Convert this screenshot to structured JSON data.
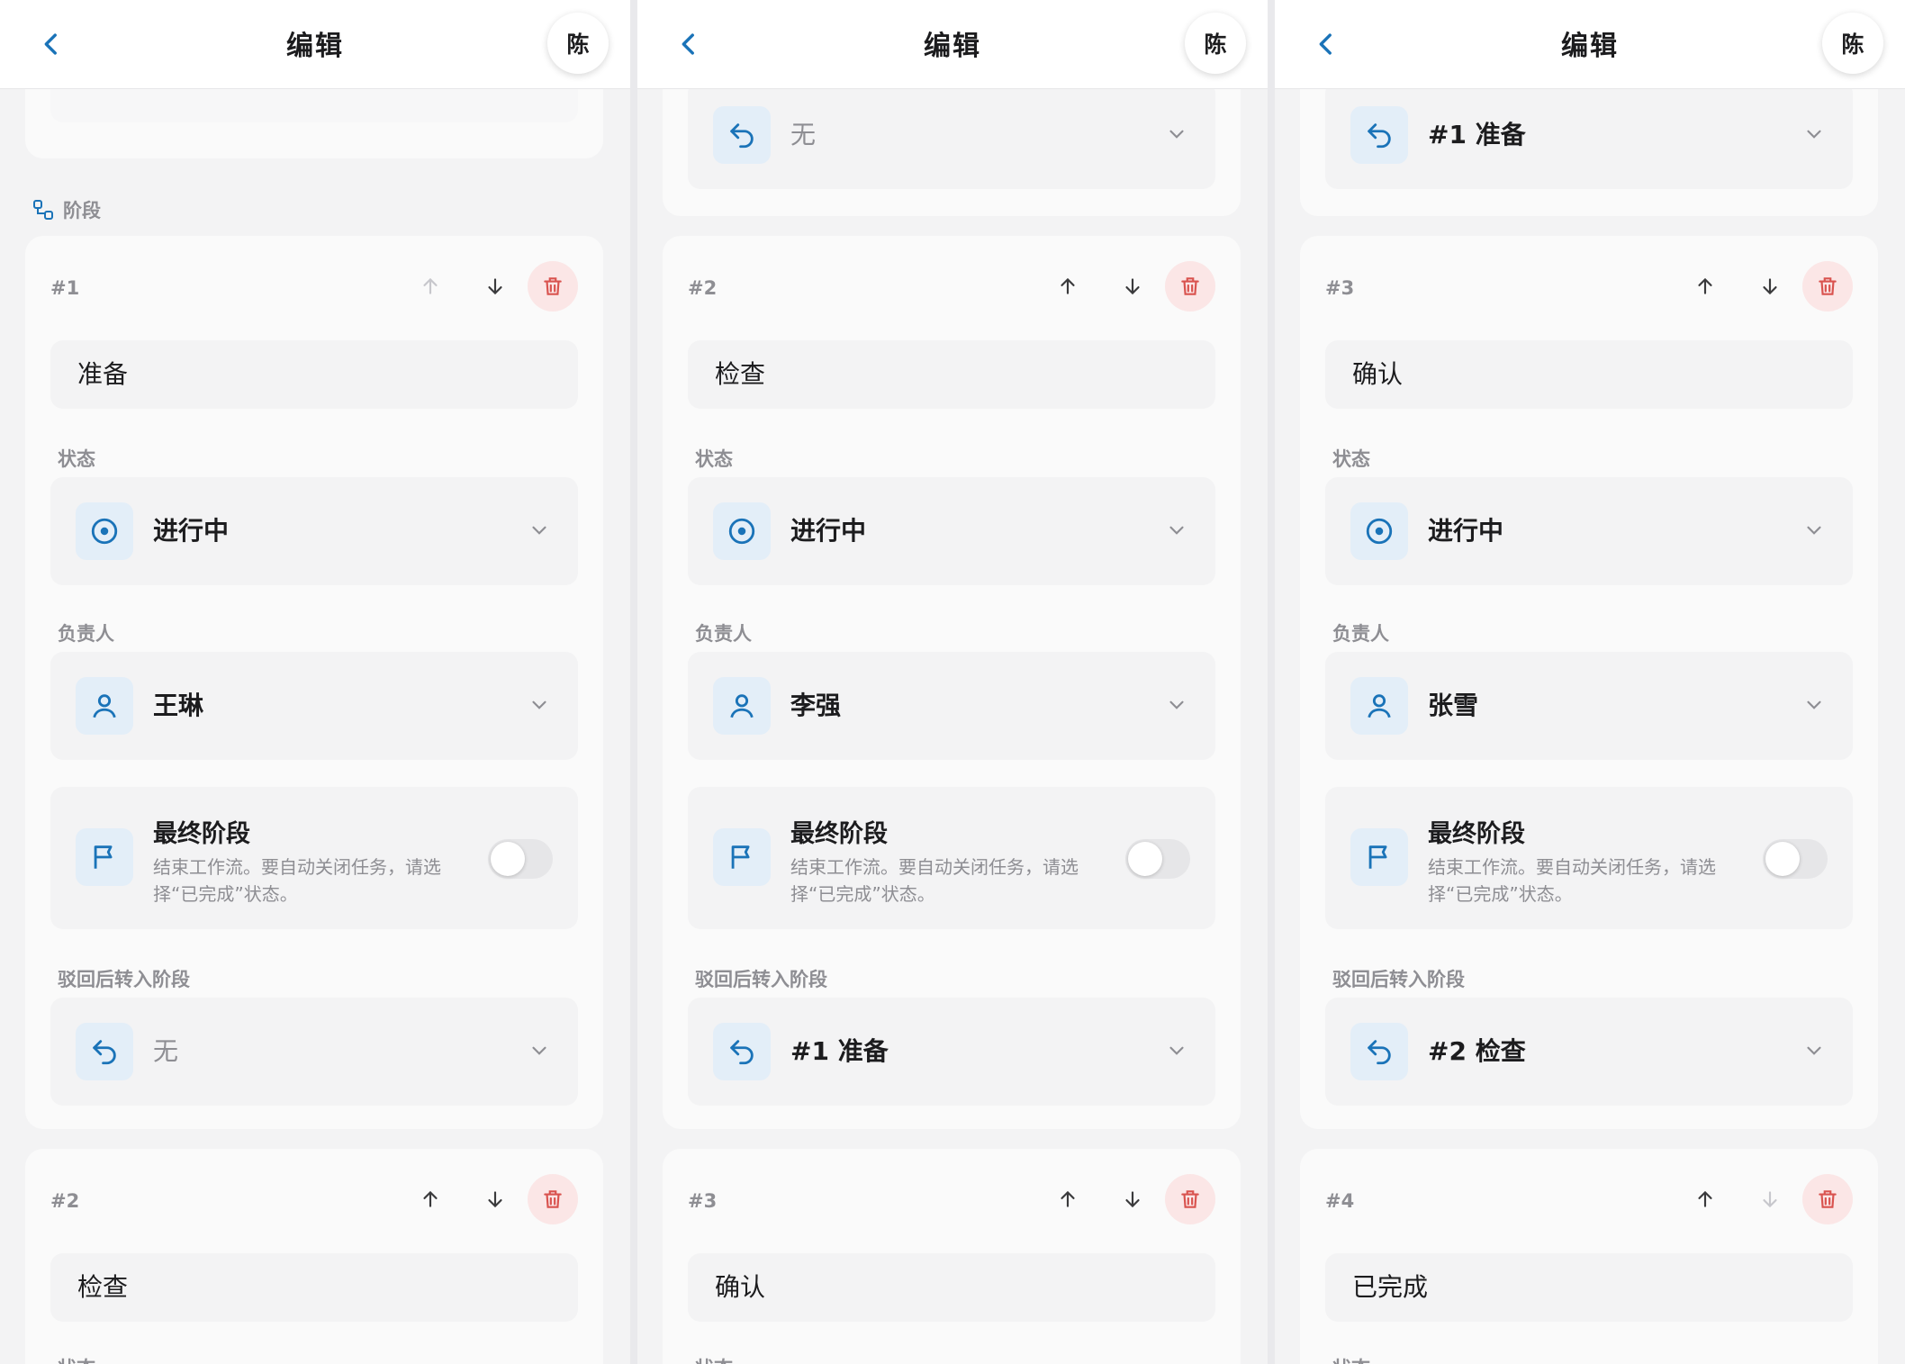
{
  "panels": [
    {
      "title": "编辑",
      "avatar": "陈",
      "section_label": "阶段",
      "stages": [
        {
          "num": "#1",
          "name": "准备",
          "status_label": "状态",
          "status": "进行中",
          "owner_label": "负责人",
          "owner": "王琳",
          "final_title": "最终阶段",
          "final_desc": "结束工作流。要自动关闭任务，请选择“已完成”状态。",
          "reject_label": "驳回后转入阶段",
          "reject": "无"
        },
        {
          "num": "#2",
          "name": "检查",
          "status_label": "状态"
        }
      ]
    },
    {
      "title": "编辑",
      "avatar": "陈",
      "prev_reject": "无",
      "stages": [
        {
          "num": "#2",
          "name": "检查",
          "status_label": "状态",
          "status": "进行中",
          "owner_label": "负责人",
          "owner": "李强",
          "final_title": "最终阶段",
          "final_desc": "结束工作流。要自动关闭任务，请选择“已完成”状态。",
          "reject_label": "驳回后转入阶段",
          "reject": "#1 准备"
        },
        {
          "num": "#3",
          "name": "确认",
          "status_label": "状态"
        }
      ]
    },
    {
      "title": "编辑",
      "avatar": "陈",
      "prev_reject": "#1 准备",
      "stages": [
        {
          "num": "#3",
          "name": "确认",
          "status_label": "状态",
          "status": "进行中",
          "owner_label": "负责人",
          "owner": "张雪",
          "final_title": "最终阶段",
          "final_desc": "结束工作流。要自动关闭任务，请选择“已完成”状态。",
          "reject_label": "驳回后转入阶段",
          "reject": "#2 检查"
        },
        {
          "num": "#4",
          "name": "已完成",
          "status_label": "状态"
        }
      ]
    }
  ],
  "colors": {
    "accent": "#1a73b8",
    "danger": "#d9534f",
    "muted": "#8e8e93",
    "icon_bg": "#e3eef8"
  }
}
